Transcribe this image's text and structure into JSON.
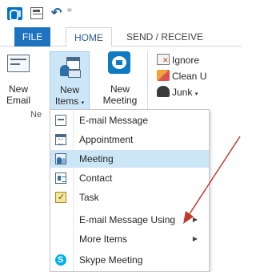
{
  "qat": {
    "app_icon": "outlook-icon",
    "send_receive_icon": "send-receive-all-icon",
    "undo_icon": "undo-icon",
    "customize_glyph": "="
  },
  "tabs": [
    {
      "label": "FILE"
    },
    {
      "label": "HOME"
    },
    {
      "label": "SEND / RECEIVE"
    }
  ],
  "ribbon": {
    "new_email": {
      "line1": "New",
      "line2": "Email"
    },
    "new_items": {
      "line1": "New",
      "line2": "Items"
    },
    "new_meeting": {
      "line1": "New",
      "line2": "Meeting"
    },
    "ignore": "Ignore",
    "clean_up": "Clean U",
    "junk": "Junk"
  },
  "group_label_fragment": "Ne",
  "menu": {
    "items": [
      {
        "label": "E-mail Message",
        "icon": "email-message-icon"
      },
      {
        "label": "Appointment",
        "icon": "appointment-icon"
      },
      {
        "label": "Meeting",
        "icon": "meeting-icon",
        "highlighted": true
      },
      {
        "label": "Contact",
        "icon": "contact-icon"
      },
      {
        "label": "Task",
        "icon": "task-icon"
      },
      {
        "label": "E-mail Message Using",
        "submenu": true
      },
      {
        "label": "More Items",
        "submenu": true
      },
      {
        "label": "Skype Meeting",
        "icon": "skype-icon"
      }
    ]
  },
  "colors": {
    "file_tab": "#1e73be",
    "highlight": "#cde6f7",
    "arrow": "#c0392b"
  }
}
